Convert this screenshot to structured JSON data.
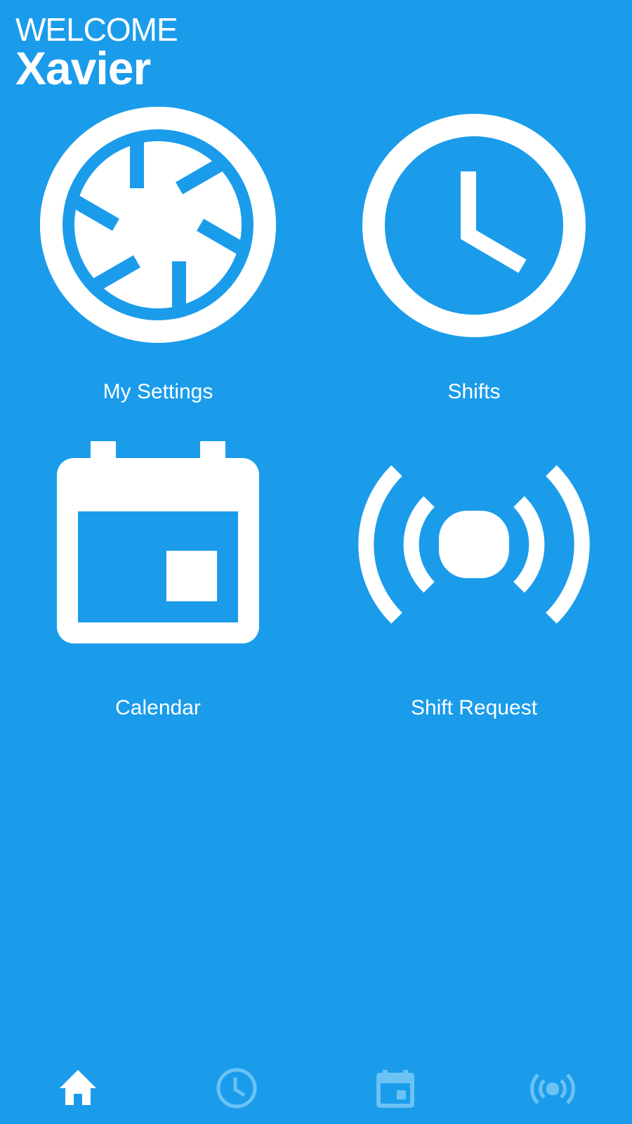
{
  "header": {
    "welcome": "WELCOME",
    "user_name": "Xavier"
  },
  "tiles": [
    {
      "label": "My Settings",
      "icon": "aperture-icon"
    },
    {
      "label": "Shifts",
      "icon": "clock-icon"
    },
    {
      "label": "Calendar",
      "icon": "calendar-icon"
    },
    {
      "label": "Shift Request",
      "icon": "broadcast-icon"
    }
  ],
  "tabbar": {
    "items": [
      {
        "name": "home",
        "icon": "home-icon",
        "active": true
      },
      {
        "name": "shifts",
        "icon": "clock-icon",
        "active": false
      },
      {
        "name": "calendar",
        "icon": "calendar-icon",
        "active": false
      },
      {
        "name": "shift-request",
        "icon": "broadcast-icon",
        "active": false
      }
    ]
  },
  "colors": {
    "background": "#1a9ceb",
    "foreground": "#ffffff",
    "tab_inactive": "#6cc2f4"
  }
}
